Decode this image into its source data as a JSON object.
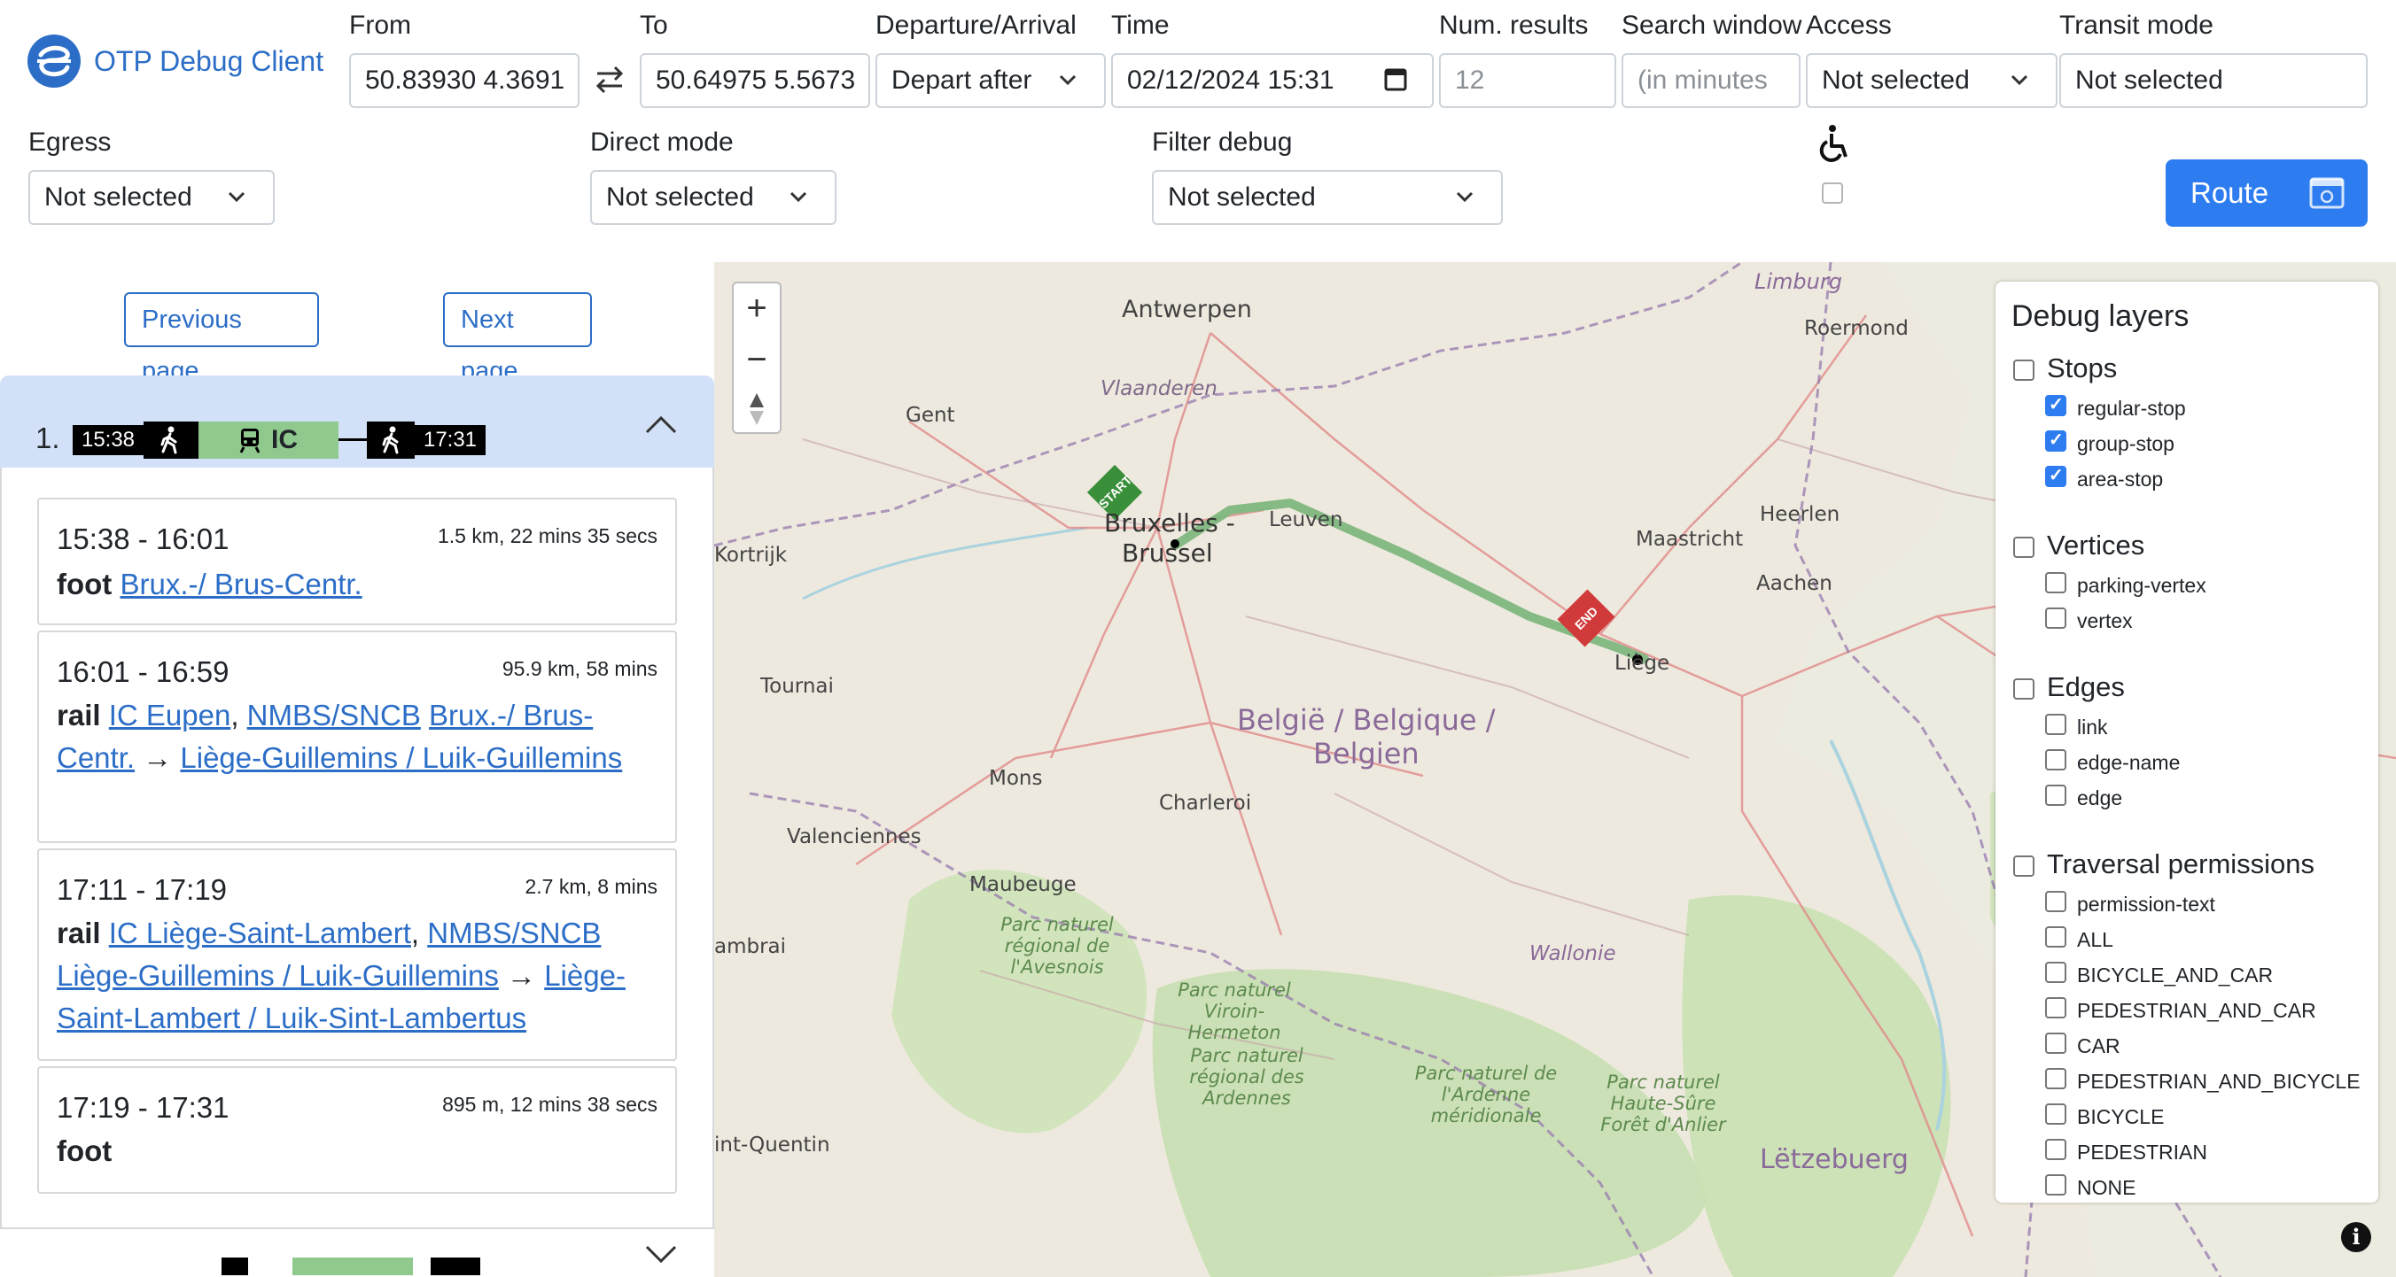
{
  "app": {
    "title": "OTP Debug Client"
  },
  "search": {
    "from_label": "From",
    "from_value": "50.83930 4.3691",
    "to_label": "To",
    "to_value": "50.64975 5.5673",
    "departure_label": "Departure/Arrival",
    "departure_value": "Depart after",
    "time_label": "Time",
    "time_value": "02/12/2024 15:31",
    "num_results_label": "Num. results",
    "num_results_placeholder": "12",
    "search_window_label": "Search window",
    "search_window_placeholder": "(in minutes",
    "access_label": "Access",
    "access_value": "Not selected",
    "transit_mode_label": "Transit mode",
    "transit_mode_value": "Not selected",
    "egress_label": "Egress",
    "egress_value": "Not selected",
    "direct_mode_label": "Direct mode",
    "direct_mode_value": "Not selected",
    "filter_debug_label": "Filter debug",
    "filter_debug_value": "Not selected",
    "wheelchair_checked": false,
    "route_label": "Route"
  },
  "pager": {
    "previous": "Previous page",
    "next": "Next page"
  },
  "itinerary": {
    "index": "1.",
    "start_time": "15:38",
    "end_time": "17:31",
    "route_short": "IC",
    "legs": [
      {
        "time": "15:38 - 16:01",
        "distance": "1.5 km, 22 mins 35 secs",
        "mode": "foot",
        "place": "Brux.-/ Brus-Centr."
      },
      {
        "time": "16:01 - 16:59",
        "distance": "95.9 km, 58 mins",
        "mode": "rail",
        "route": "IC Eupen",
        "agency": "NMBS/SNCB",
        "from": "Brux.-/ Brus-Centr.",
        "arrow": "→",
        "to": "Liège-Guillemins / Luik-Guillemins"
      },
      {
        "time": "17:11 - 17:19",
        "distance": "2.7 km, 8 mins",
        "mode": "rail",
        "route": "IC Liège-Saint-Lambert",
        "agency": "NMBS/SNCB",
        "from": "Liège-Guillemins / Luik-Guillemins",
        "arrow": "→",
        "to": "Liège-Saint-Lambert / Luik-Sint-Lambertus"
      },
      {
        "time": "17:19 - 17:31",
        "distance": "895 m, 12 mins 38 secs",
        "mode": "foot"
      }
    ]
  },
  "map": {
    "zoom_in": "+",
    "zoom_out": "−",
    "labels": {
      "antwerpen": "Antwerpen",
      "vlaanderen": "Vlaanderen",
      "gent": "Gent",
      "kortrijk": "Kortrijk",
      "bruxelles": "Bruxelles -",
      "brussel": "Brussel",
      "leuven": "Leuven",
      "maastricht": "Maastricht",
      "heerlen": "Heerlen",
      "aachen": "Aachen",
      "liege": "Liège",
      "tournai": "Tournai",
      "belgie1": "België / Belgique /",
      "belgie2": "Belgien",
      "mons": "Mons",
      "charleroi": "Charleroi",
      "valenciennes": "Valenciennes",
      "maubeuge": "Maubeuge",
      "avesnois": "Parc naturel régional de l'Avesnois",
      "viroin": "Parc naturel Viroin-Hermeton",
      "ardennes_fr": "Parc naturel régional des Ardennes",
      "ardenne_be": "Parc naturel de l'Ardenne méridionale",
      "haute_sure": "Parc naturel Haute-Sûre Forêt d'Anlier",
      "wallonie": "Wallonie",
      "letzebuerg": "Lëtzebuerg",
      "limburg": "Limburg",
      "roermond": "Roermond",
      "quentin": "int-Quentin",
      "ambrai": "ambrai",
      "start": "START",
      "end": "END"
    }
  },
  "debug_layers": {
    "title": "Debug layers",
    "groups": [
      {
        "label": "Stops",
        "checked": false,
        "items": [
          {
            "label": "regular-stop",
            "checked": true
          },
          {
            "label": "group-stop",
            "checked": true
          },
          {
            "label": "area-stop",
            "checked": true
          }
        ]
      },
      {
        "label": "Vertices",
        "checked": false,
        "items": [
          {
            "label": "parking-vertex",
            "checked": false
          },
          {
            "label": "vertex",
            "checked": false
          }
        ]
      },
      {
        "label": "Edges",
        "checked": false,
        "items": [
          {
            "label": "link",
            "checked": false
          },
          {
            "label": "edge-name",
            "checked": false
          },
          {
            "label": "edge",
            "checked": false
          }
        ]
      },
      {
        "label": "Traversal permissions",
        "checked": false,
        "items": [
          {
            "label": "permission-text",
            "checked": false
          },
          {
            "label": "ALL",
            "checked": false
          },
          {
            "label": "BICYCLE_AND_CAR",
            "checked": false
          },
          {
            "label": "PEDESTRIAN_AND_CAR",
            "checked": false
          },
          {
            "label": "CAR",
            "checked": false
          },
          {
            "label": "PEDESTRIAN_AND_BICYCLE",
            "checked": false
          },
          {
            "label": "BICYCLE",
            "checked": false
          },
          {
            "label": "PEDESTRIAN",
            "checked": false
          },
          {
            "label": "NONE",
            "checked": false
          }
        ]
      }
    ]
  },
  "colors": {
    "accent": "#2d7cf0",
    "link": "#2c6ec7",
    "route_line": "#7fb77e",
    "header_bg": "#d3e1f8"
  }
}
